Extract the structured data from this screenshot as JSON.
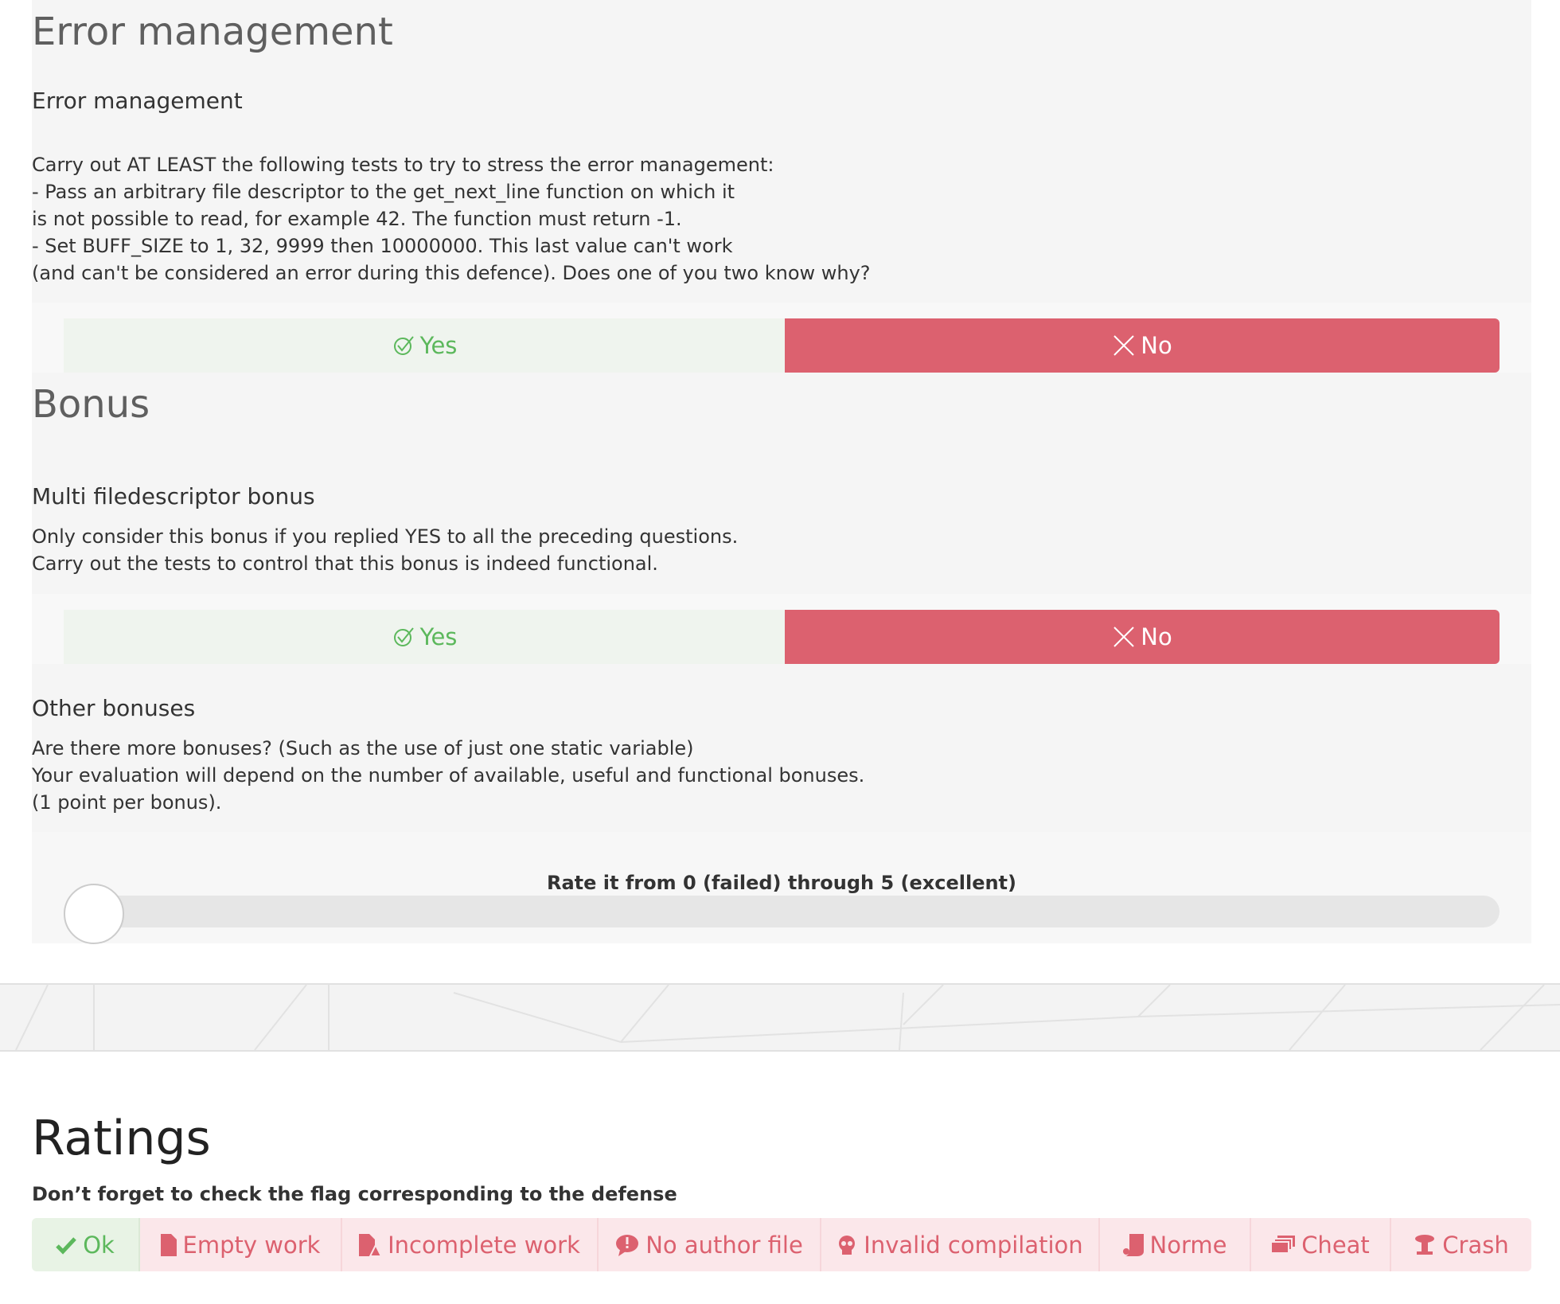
{
  "sections": {
    "error": {
      "heading": "Error management",
      "question_title": "Error management",
      "description": "Carry out AT LEAST the following tests to try to stress the error management:\n- Pass an arbitrary file descriptor to the get_next_line function on which it\nis not possible to read, for example 42. The function must return -1.\n- Set BUFF_SIZE to 1, 32, 9999 then 10000000. This last value can't work\n(and can't be considered an error during this defence). Does one of you two know why?",
      "yes_label": "Yes",
      "no_label": "No",
      "selected": "No"
    },
    "bonus": {
      "heading": "Bonus",
      "multi_fd": {
        "question_title": "Multi filedescriptor bonus",
        "description": "Only consider this bonus if you replied YES to all the preceding questions.\nCarry out the tests to control that this bonus is indeed functional.",
        "yes_label": "Yes",
        "no_label": "No",
        "selected": "No"
      },
      "other": {
        "question_title": "Other bonuses",
        "description": "Are there more bonuses? (Such as the use of just one static variable)\nYour evaluation will depend on the number of available, useful and functional bonuses.\n(1 point per bonus).",
        "rate_label": "Rate it from 0 (failed) through 5 (excellent)",
        "rate_value": 0
      }
    }
  },
  "ratings": {
    "title": "Ratings",
    "note": "Don’t forget to check the flag corresponding to the defense",
    "flags": [
      {
        "label": "Ok",
        "icon": "check-icon"
      },
      {
        "label": "Empty work",
        "icon": "file-icon"
      },
      {
        "label": "Incomplete work",
        "icon": "incomplete-file-icon"
      },
      {
        "label": "No author file",
        "icon": "comment-alert-icon"
      },
      {
        "label": "Invalid compilation",
        "icon": "skull-icon"
      },
      {
        "label": "Norme",
        "icon": "scroll-icon"
      },
      {
        "label": "Cheat",
        "icon": "stack-icon"
      },
      {
        "label": "Crash",
        "icon": "explosion-icon"
      }
    ]
  },
  "colors": {
    "yes_text": "#5cb85c",
    "no_bg": "#dc616f",
    "flag_text": "#dc616f"
  }
}
